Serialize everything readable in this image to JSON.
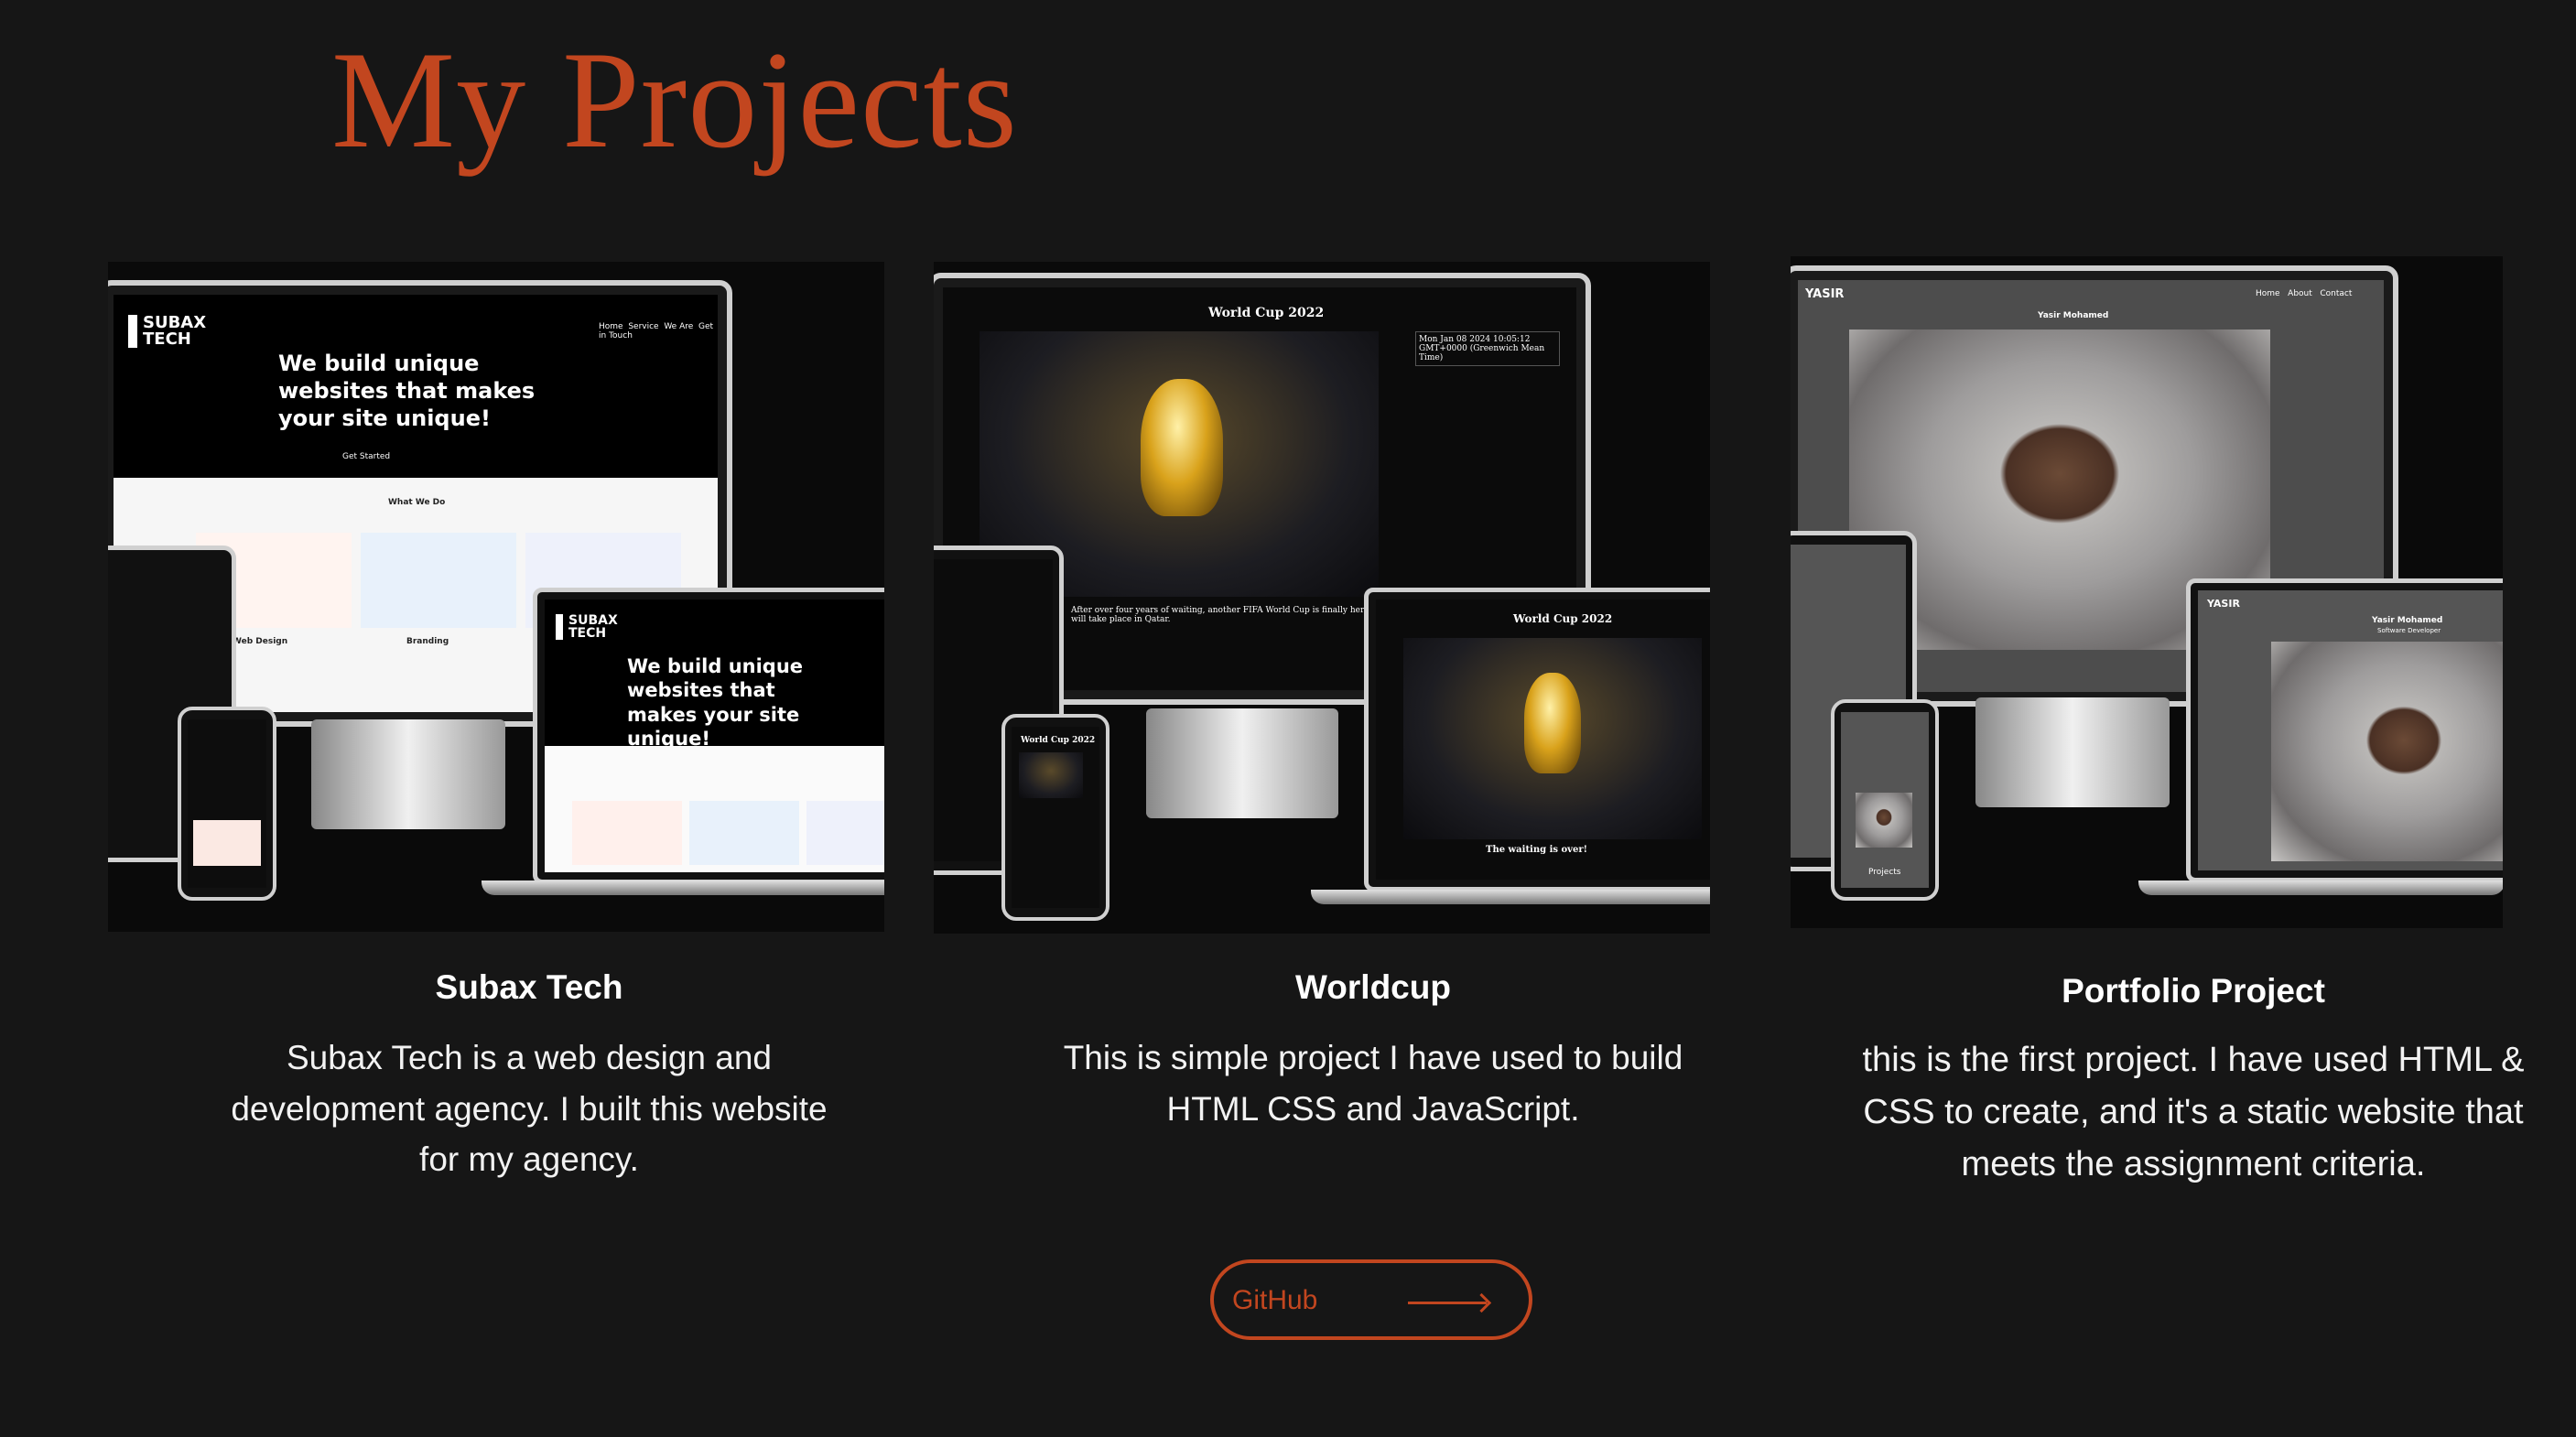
{
  "page": {
    "title": "My Projects",
    "accent_color": "#c2461f",
    "background_color": "#161616"
  },
  "projects": [
    {
      "name": "Subax Tech",
      "description": "Subax Tech is a web design and development agency. I built this website for my agency.",
      "mockup": {
        "logo": "SUBAX TECH",
        "nav": [
          "Home",
          "Service",
          "We Are",
          "Get in Touch"
        ],
        "hero": "We build unique websites that makes your site unique!",
        "cta": "Get Started",
        "section": "What We Do",
        "services": [
          "Web Design",
          "Branding"
        ]
      }
    },
    {
      "name": "Worldcup",
      "description": "This is simple project I have used to build HTML CSS and JavaScript.",
      "mockup": {
        "heading": "World Cup 2022",
        "clock": "Mon Jan 08 2024 10:05:12 GMT+0000 (Greenwich Mean Time)",
        "subheading": "The waiting is over!",
        "body": "After over four years of waiting, another FIFA World Cup is finally here. The 2022 FIFA World Cup tournament will take place in Qatar."
      }
    },
    {
      "name": "Portfolio Project",
      "description": "this is the first project. I have used HTML & CSS to create, and it's a static website that meets the assignment criteria.",
      "mockup": {
        "logo": "YASIR",
        "nav": [
          "Home",
          "About",
          "Contact"
        ],
        "owner": "Yasir Mohamed",
        "role": "Software Developer",
        "section": "Projects"
      }
    }
  ],
  "github_button": {
    "label": "GitHub",
    "icon": "arrow-right-icon"
  }
}
